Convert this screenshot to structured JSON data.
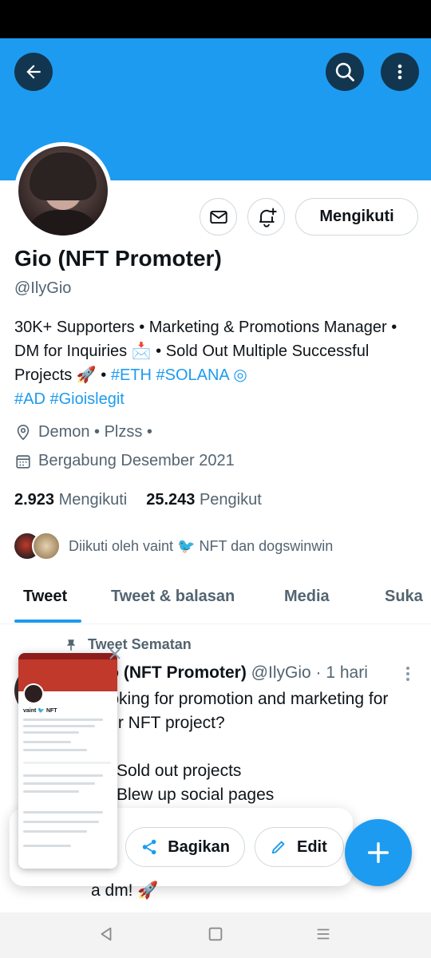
{
  "profile": {
    "name": "Gio (NFT Promoter)",
    "handle": "@IlyGio",
    "follow_label": "Mengikuti",
    "bio_text": "30K+ Supporters • Marketing & Promotions Manager • DM for Inquiries 📩 • Sold Out Multiple Successful Projects 🚀 • ",
    "bio_links_1": "#ETH #SOLANA ◎",
    "bio_links_2": "#AD #Gioislegit",
    "location": "Demon • Plzss •",
    "joined": "Bergabung Desember 2021",
    "following_count": "2.923",
    "following_label": "Mengikuti",
    "followers_count": "25.243",
    "followers_label": "Pengikut",
    "followed_by": "Diikuti oleh vaint 🐦 NFT dan dogswinwin"
  },
  "tabs": [
    {
      "label": "Tweet"
    },
    {
      "label": "Tweet & balasan"
    },
    {
      "label": "Media"
    },
    {
      "label": "Suka"
    }
  ],
  "pinned_tweet": {
    "pinned_label": "Tweet Sematan",
    "author_name": "Gio (NFT Promoter)",
    "author_handle": "@IlyGio",
    "time": "· 1 hari",
    "text": "Looking for promotion and marketing for your NFT project?\n\n✅ Sold out projects\n✅ Blew up social pages",
    "tail": "a dm! 🚀"
  },
  "share_sheet": {
    "share_label": "Bagikan",
    "edit_label": "Edit"
  },
  "preview": {
    "name": "vaint 🐦 NFT"
  },
  "icons": {
    "back": "arrow-left-icon",
    "search": "search-icon",
    "more": "more-vertical-icon",
    "message": "envelope-icon",
    "notify": "bell-plus-icon",
    "location": "map-pin-icon",
    "calendar": "calendar-icon",
    "pin": "pin-icon",
    "share": "share-icon",
    "edit": "pencil-icon",
    "compose": "plus-icon",
    "close": "close-icon"
  },
  "colors": {
    "accent": "#1d9bf0",
    "text": "#0f1419",
    "muted": "#536471"
  }
}
